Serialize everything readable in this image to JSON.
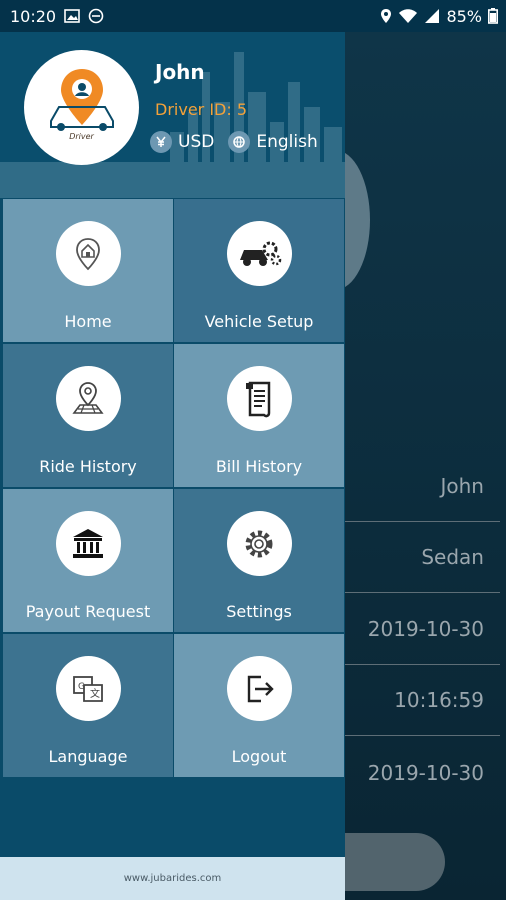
{
  "status_bar": {
    "time": "10:20",
    "battery": "85%"
  },
  "background_screen": {
    "rows": [
      "John",
      "Sedan",
      "2019-10-30",
      "10:16:59",
      "2019-10-30"
    ]
  },
  "drawer": {
    "profile": {
      "name": "John",
      "driver_id": "Driver ID: 5",
      "avatar_caption": "Driver",
      "currency": "USD",
      "language": "English"
    },
    "menu": [
      {
        "label": "Home",
        "icon": "home-pin-icon"
      },
      {
        "label": "Vehicle Setup",
        "icon": "vehicle-gears-icon"
      },
      {
        "label": "Ride History",
        "icon": "map-pin-icon"
      },
      {
        "label": "Bill History",
        "icon": "receipt-scroll-icon"
      },
      {
        "label": "Payout Request",
        "icon": "bank-icon"
      },
      {
        "label": "Settings",
        "icon": "gear-icon"
      },
      {
        "label": "Language",
        "icon": "translate-icon"
      },
      {
        "label": "Logout",
        "icon": "logout-icon"
      }
    ],
    "footer": "www.jubarides.com"
  },
  "colors": {
    "accent_orange": "#f3a23a",
    "drawer_bg": "#0a4b69",
    "tile_light": "#6e9bb3",
    "tile_dark": "#3d7390"
  }
}
